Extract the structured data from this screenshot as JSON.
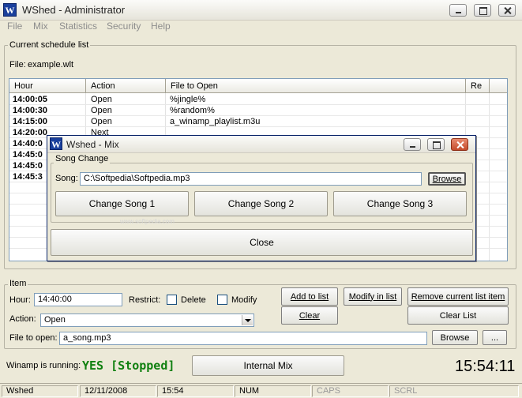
{
  "window": {
    "title": "WShed - Administrator",
    "icon_letter": "W"
  },
  "menu": [
    "File",
    "Mix",
    "Statistics",
    "Security",
    "Help"
  ],
  "schedule": {
    "group_label": "Current schedule list",
    "file_label": "File:",
    "file_name": "example.wlt",
    "columns": [
      "Hour",
      "Action",
      "File to Open",
      "Re"
    ],
    "rows": [
      {
        "hour": "14:00:05",
        "action": "Open",
        "file": "%jingle%"
      },
      {
        "hour": "14:00:30",
        "action": "Open",
        "file": "%random%"
      },
      {
        "hour": "14:15:00",
        "action": "Open",
        "file": "a_winamp_playlist.m3u"
      },
      {
        "hour": "14:20:00",
        "action": "Next",
        "file": ""
      },
      {
        "hour": "14:40:0",
        "action": "",
        "file": ""
      },
      {
        "hour": "14:45:0",
        "action": "",
        "file": ""
      },
      {
        "hour": "14:45:0",
        "action": "",
        "file": ""
      },
      {
        "hour": "14:45:3",
        "action": "",
        "file": ""
      }
    ]
  },
  "mix_dialog": {
    "title": "Wshed - Mix",
    "icon_letter": "W",
    "group_label": "Song Change",
    "song_label": "Song:",
    "song_value": "C:\\Softpedia\\Softpedia.mp3",
    "browse_label": "Browse",
    "change_buttons": [
      "Change Song 1",
      "Change Song 2",
      "Change Song 3"
    ],
    "close_label": "Close",
    "watermark": "www.softpedia.com"
  },
  "item": {
    "group_label": "Item",
    "hour_label": "Hour:",
    "hour_value": "14:40:00",
    "restrict_label": "Restrict:",
    "delete_label": "Delete",
    "modify_label": "Modify",
    "action_label": "Action:",
    "action_value": "Open",
    "file_label": "File to open:",
    "file_value": "a_song.mp3",
    "add_label": "Add to list",
    "modify_in_list_label": "Modify in list",
    "remove_label": "Remove current list item",
    "clear_label": "Clear",
    "clear_list_label": "Clear List",
    "browse_label": "Browse",
    "ellipsis_label": "..."
  },
  "winamp": {
    "label": "Winamp is running:",
    "status": "YES [Stopped]",
    "internal_mix_label": "Internal Mix",
    "clock": "15:54:11"
  },
  "statusbar": [
    "Wshed",
    "12/11/2008",
    "15:54",
    "NUM",
    "CAPS",
    "SCRL"
  ],
  "colors": {
    "status_green": "#108010",
    "title_blue": "#1a3f9c"
  }
}
